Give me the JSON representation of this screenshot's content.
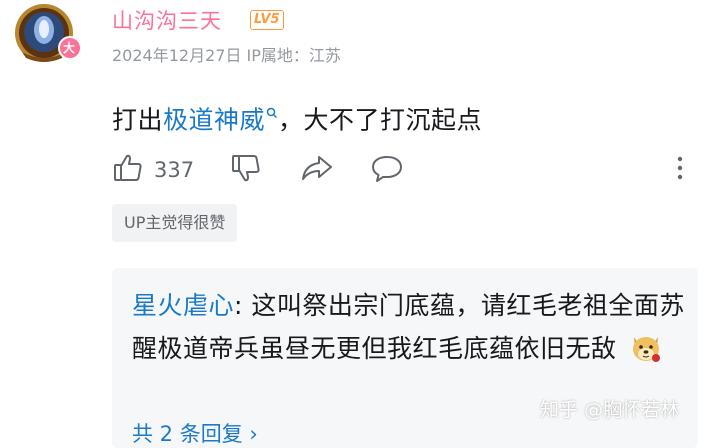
{
  "comment": {
    "username": "山沟沟三天",
    "level_badge": "LV5",
    "meta": "2024年12月27日 IP属地：江苏",
    "content_prefix": "打出",
    "content_keyword": "极道神威",
    "content_suffix": "，大不了打沉起点",
    "like_count": "337",
    "up_badge": "UP主觉得很赞",
    "avatar_badge": "大"
  },
  "reply": {
    "username": "星火虐心",
    "text": ": 这叫祭出宗门底蕴，请红毛老祖全面苏醒极道帝兵虽昼无更但我红毛底蕴依旧无敌",
    "emoji": "doge-emoji",
    "more_label": "共 2 条回复 ›"
  },
  "watermark": "知乎 @胸怀若林",
  "colors": {
    "username": "#fb7299",
    "link": "#1a7ac8",
    "level": "#ff9b3d",
    "meta": "#9499a0"
  }
}
